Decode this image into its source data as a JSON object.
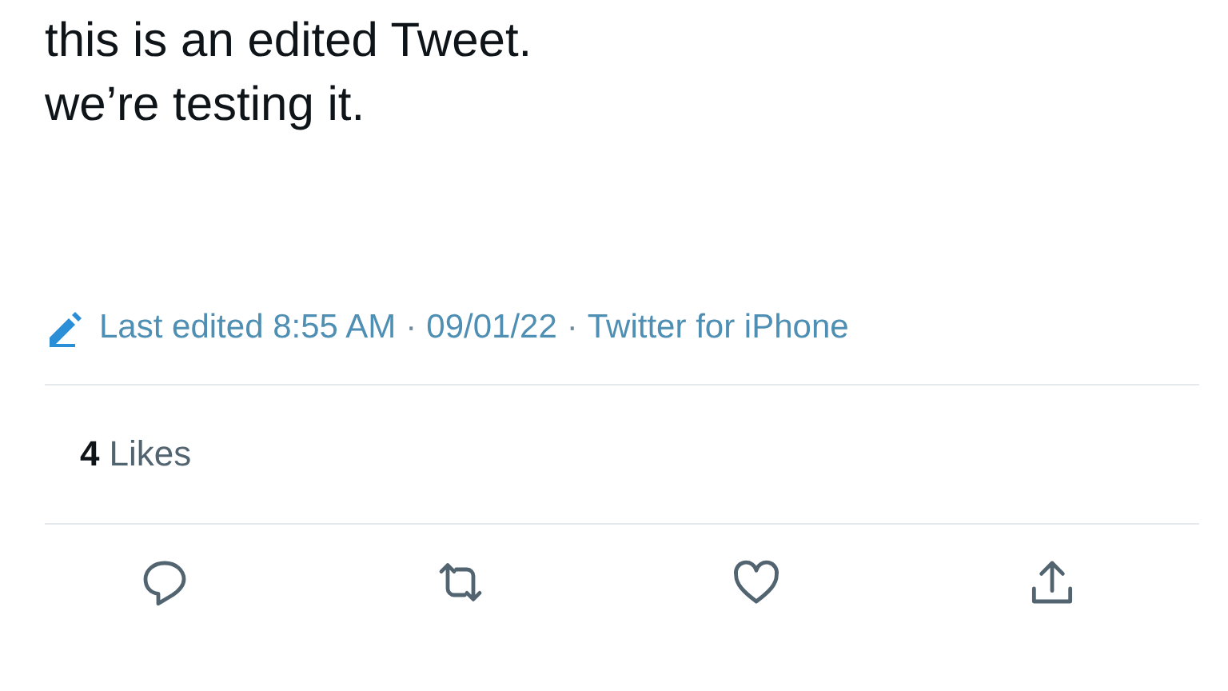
{
  "tweet": {
    "lines": [
      "this is an edited Tweet.",
      "we’re testing it."
    ]
  },
  "meta": {
    "edited": "Last edited 8:55 AM",
    "parts": [
      {
        "separator": "·",
        "text": "09/01/22"
      },
      {
        "separator": "·",
        "text": "Twitter for iPhone"
      }
    ]
  },
  "likes": {
    "count": "4",
    "label": "Likes"
  },
  "actions": [
    {
      "kind": "reply"
    },
    {
      "kind": "retweet"
    },
    {
      "kind": "like"
    },
    {
      "kind": "share"
    }
  ]
}
